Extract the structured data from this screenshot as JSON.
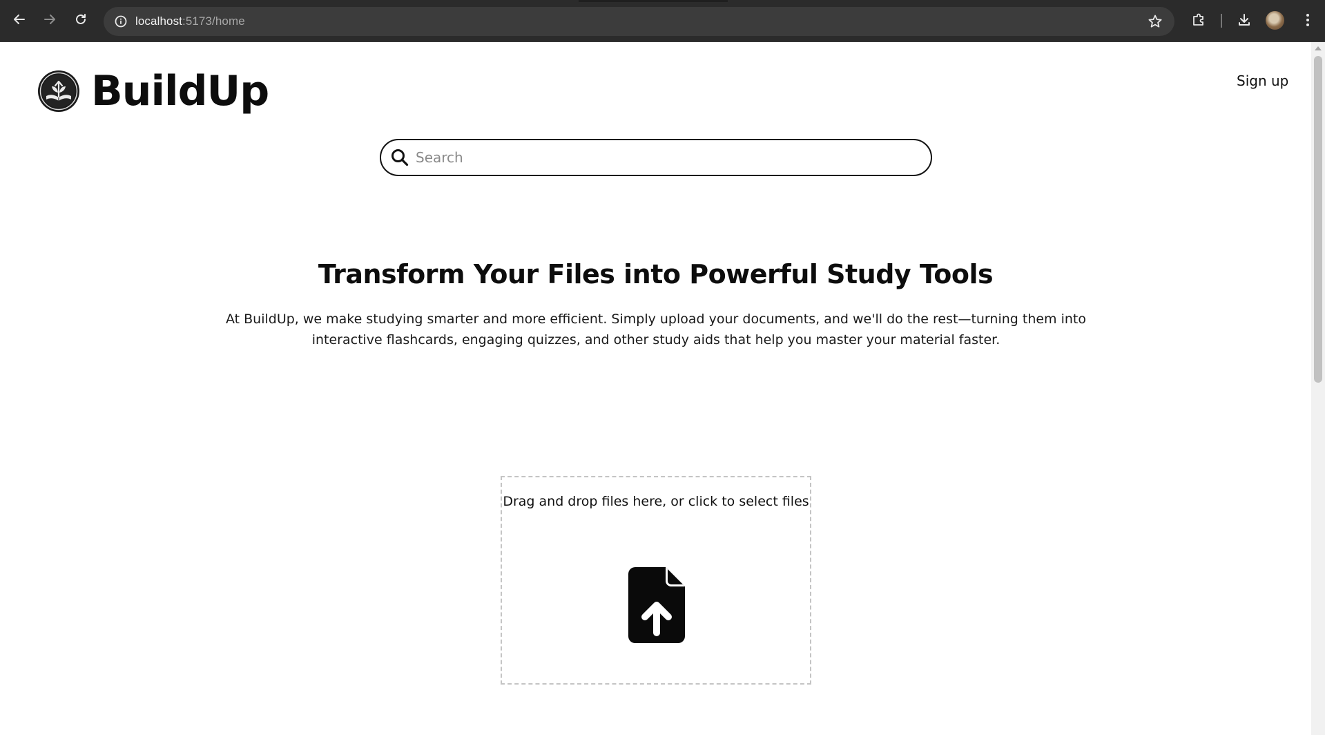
{
  "browser": {
    "url_host": "localhost",
    "url_rest": ":5173/home"
  },
  "header": {
    "logo_text": "BuildUp",
    "signup_label": "Sign up"
  },
  "search": {
    "placeholder": "Search"
  },
  "hero": {
    "title": "Transform Your Files into Powerful Study Tools",
    "description": "At BuildUp, we make studying smarter and more efficient. Simply upload your documents, and we'll do the rest—turning them into interactive flashcards, engaging quizzes, and other study aids that help you master your material faster."
  },
  "upload": {
    "prompt": "Drag and drop files here, or click to select files"
  },
  "icons": {
    "back": "arrow-left-icon",
    "forward": "arrow-right-icon",
    "reload": "reload-icon",
    "site_info": "info-icon",
    "bookmark": "star-icon",
    "extensions": "puzzle-icon",
    "downloads": "download-icon",
    "menu": "kebab-menu-icon",
    "search": "search-icon",
    "upload": "file-upload-icon"
  }
}
